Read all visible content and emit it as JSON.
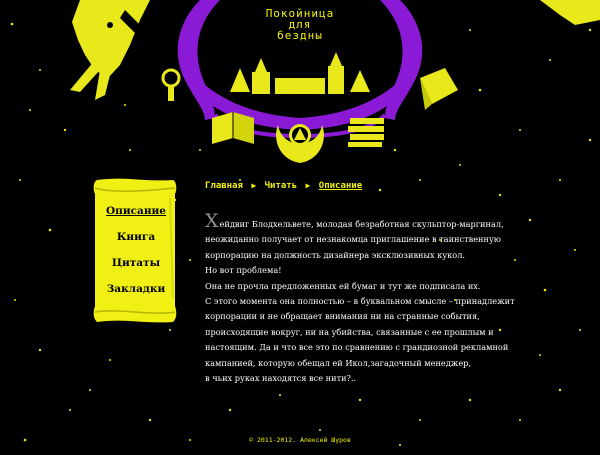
{
  "site": {
    "title_lines": [
      "Покойница",
      "для",
      "бездны"
    ]
  },
  "breadcrumb": {
    "items": [
      "Главная",
      "Читать",
      "Описание"
    ]
  },
  "menu": {
    "items": [
      "Описание",
      "Книга",
      "Цитаты",
      "Закладки"
    ],
    "active": 0
  },
  "content": {
    "dropcap": "Х",
    "lines": [
      "ейдвиг Блодхельвете, молодая безработная скульптор-маргинал,",
      "неожиданно получает от незнакомца приглашение в таинственную",
      "корпорацию на должность дизайнера эксклюзивных кукол.",
      "Но вот проблема!",
      "Она не прочла предложенных ей бумаг и тут же подписала их.",
      "С этого момента она полностью – в буквальном смысле – принадлежит",
      "корпорации и не обращает внимания ни на странные события,",
      "происходящие вокруг, ни на убийства, связанные с ее прошлым и",
      "настоящим. Да и что все это по сравнению с грандиозной рекламной",
      "кампанией, которую обещал ей Икол,загадочный менеджер,",
      "в чьих руках находятся все нити?.."
    ]
  },
  "footer": {
    "copyright": "© 2011-2012. Алексей Шуров"
  },
  "colors": {
    "background": "#000000",
    "accent_yellow": "#f2f20a",
    "accent_purple": "#8a1ad6",
    "text": "#ffffff"
  },
  "icons": [
    "bird-icon",
    "keyhole-icon",
    "open-book-icon",
    "portrait-wreath-icon",
    "book-stack-icon",
    "folded-paper-icon",
    "scroll-icon",
    "castle-icon"
  ]
}
